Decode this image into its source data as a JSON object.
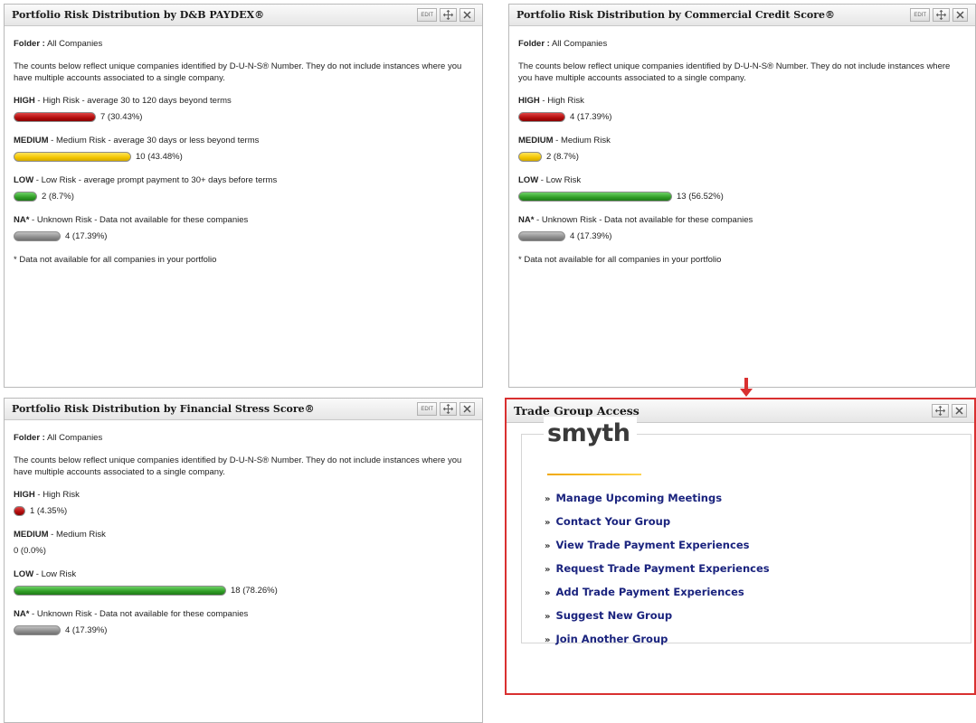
{
  "panels": {
    "paydex": {
      "title": "Portfolio Risk Distribution by D&B PAYDEX®",
      "folder_label": "Folder :",
      "folder_value": "All Companies",
      "description": "The counts below reflect unique companies identified by D-U-N-S® Number. They do not include instances where you have multiple accounts associated to a single company.",
      "risks": [
        {
          "name": "HIGH",
          "desc": " - High Risk - average 30 to 120 days beyond terms",
          "count": "7 (30.43%)",
          "percent": 30.43
        },
        {
          "name": "MEDIUM",
          "desc": " - Medium Risk - average 30 days or less beyond terms",
          "count": "10 (43.48%)",
          "percent": 43.48
        },
        {
          "name": "LOW",
          "desc": " - Low Risk - average prompt payment to 30+ days before terms",
          "count": "2 (8.7%)",
          "percent": 8.7
        },
        {
          "name": "NA*",
          "desc": " - Unknown Risk - Data not available for these companies",
          "count": "4 (17.39%)",
          "percent": 17.39
        }
      ],
      "footnote": "* Data not available for all companies in your portfolio"
    },
    "credit": {
      "title": "Portfolio Risk Distribution by Commercial Credit Score®",
      "folder_label": "Folder :",
      "folder_value": "All Companies",
      "description": "The counts below reflect unique companies identified by D-U-N-S® Number. They do not include instances where you have multiple accounts associated to a single company.",
      "risks": [
        {
          "name": "HIGH",
          "desc": " - High Risk",
          "count": "4 (17.39%)",
          "percent": 17.39
        },
        {
          "name": "MEDIUM",
          "desc": " - Medium Risk",
          "count": "2 (8.7%)",
          "percent": 8.7
        },
        {
          "name": "LOW",
          "desc": " - Low Risk",
          "count": "13 (56.52%)",
          "percent": 56.52
        },
        {
          "name": "NA*",
          "desc": " - Unknown Risk - Data not available for these companies",
          "count": "4 (17.39%)",
          "percent": 17.39
        }
      ],
      "footnote": "* Data not available for all companies in your portfolio"
    },
    "stress": {
      "title": "Portfolio Risk Distribution by Financial Stress Score®",
      "folder_label": "Folder :",
      "folder_value": "All Companies",
      "description": "The counts below reflect unique companies identified by D-U-N-S® Number. They do not include instances where you have multiple accounts associated to a single company.",
      "risks": [
        {
          "name": "HIGH",
          "desc": " - High Risk",
          "count": "1 (4.35%)",
          "percent": 4.35
        },
        {
          "name": "MEDIUM",
          "desc": " - Medium Risk",
          "count": "0 (0.0%)",
          "percent": 0
        },
        {
          "name": "LOW",
          "desc": " - Low Risk",
          "count": "18 (78.26%)",
          "percent": 78.26
        },
        {
          "name": "NA*",
          "desc": " - Unknown Risk - Data not available for these companies",
          "count": "4 (17.39%)",
          "percent": 17.39
        }
      ]
    },
    "trade": {
      "title": "Trade Group Access",
      "logo": "smyth",
      "links": [
        "Manage Upcoming Meetings",
        "Contact Your Group",
        "View Trade Payment Experiences",
        "Request Trade Payment Experiences",
        "Add Trade Payment Experiences",
        "Suggest New Group",
        "Join Another Group"
      ]
    }
  },
  "controls": {
    "edit_label": "EDIT",
    "link_prefix": "»"
  },
  "colors": {
    "high": "#b10d0d",
    "medium": "#f2c500",
    "low": "#2f9c25",
    "na": "#8d8d8d",
    "link": "#1a237e",
    "highlight_border": "#d93030"
  },
  "icons": [
    "move-icon",
    "close-icon",
    "down-arrow-icon"
  ]
}
